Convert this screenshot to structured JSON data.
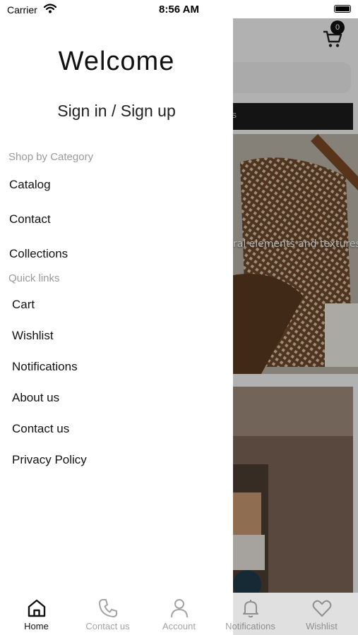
{
  "status_bar": {
    "carrier": "Carrier",
    "time": "8:56 AM"
  },
  "drawer": {
    "welcome": "Welcome",
    "sign_in": "Sign in / Sign up",
    "shop_by_category": {
      "heading": "Shop by Category",
      "items": [
        "Catalog",
        "Contact",
        "Collections"
      ]
    },
    "quick_links": {
      "heading": "Quick links",
      "items": [
        "Cart",
        "Wishlist",
        "Notifications",
        "About us",
        "Contact us",
        "Privacy Policy"
      ]
    }
  },
  "background": {
    "cart_badge": "0",
    "banner_text": "RS",
    "hero_text": "ral elements and textures"
  },
  "tabbar": {
    "tabs": [
      {
        "label": "Home",
        "icon": "home-icon",
        "active": true
      },
      {
        "label": "Contact us",
        "icon": "phone-icon",
        "active": false
      },
      {
        "label": "Account",
        "icon": "person-icon",
        "active": false
      },
      {
        "label": "Notifications",
        "icon": "bell-icon",
        "active": false
      },
      {
        "label": "Wishlist",
        "icon": "heart-icon",
        "active": false
      }
    ]
  },
  "colors": {
    "text": "#111111",
    "muted": "#9a9a9a",
    "overlay": "rgba(0,0,0,0.28)"
  }
}
